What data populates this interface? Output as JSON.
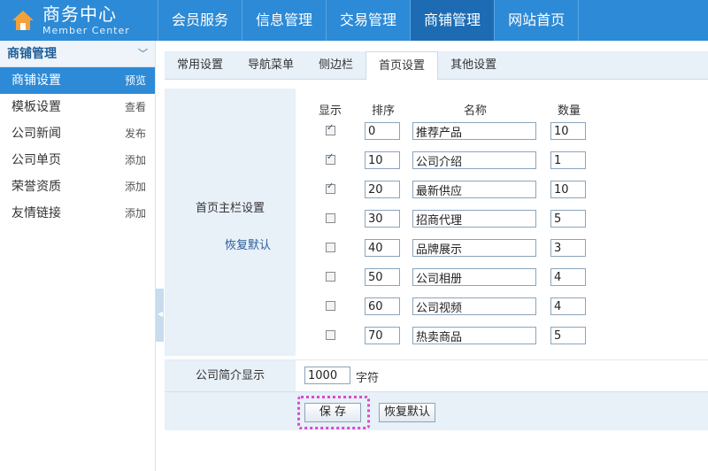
{
  "brand": {
    "title": "商务中心",
    "subtitle": "Member Center",
    "icon": "house-icon"
  },
  "nav": {
    "items": [
      {
        "label": "会员服务"
      },
      {
        "label": "信息管理"
      },
      {
        "label": "交易管理"
      },
      {
        "label": "商铺管理",
        "active": true
      },
      {
        "label": "网站首页"
      }
    ]
  },
  "sidebar": {
    "title": "商铺管理",
    "items": [
      {
        "label": "商铺设置",
        "action": "预览",
        "active": true
      },
      {
        "label": "模板设置",
        "action": "查看"
      },
      {
        "label": "公司新闻",
        "action": "发布"
      },
      {
        "label": "公司单页",
        "action": "添加"
      },
      {
        "label": "荣誉资质",
        "action": "添加"
      },
      {
        "label": "友情链接",
        "action": "添加"
      }
    ]
  },
  "tabs": [
    {
      "label": "常用设置"
    },
    {
      "label": "导航菜单"
    },
    {
      "label": "侧边栏"
    },
    {
      "label": "首页设置",
      "active": true
    },
    {
      "label": "其他设置"
    }
  ],
  "home_columns": {
    "label": "首页主栏设置",
    "restore_link": "恢复默认",
    "headers": {
      "show": "显示",
      "order": "排序",
      "name": "名称",
      "qty": "数量"
    },
    "rows": [
      {
        "show": true,
        "order": "0",
        "name": "推荐产品",
        "qty": "10"
      },
      {
        "show": true,
        "order": "10",
        "name": "公司介绍",
        "qty": "1"
      },
      {
        "show": true,
        "order": "20",
        "name": "最新供应",
        "qty": "10"
      },
      {
        "show": false,
        "order": "30",
        "name": "招商代理",
        "qty": "5"
      },
      {
        "show": false,
        "order": "40",
        "name": "品牌展示",
        "qty": "3"
      },
      {
        "show": false,
        "order": "50",
        "name": "公司相册",
        "qty": "4"
      },
      {
        "show": false,
        "order": "60",
        "name": "公司视频",
        "qty": "4"
      },
      {
        "show": false,
        "order": "70",
        "name": "热卖商品",
        "qty": "5"
      }
    ]
  },
  "intro": {
    "label": "公司简介显示",
    "value": "1000",
    "unit": "字符"
  },
  "buttons": {
    "save": "保 存",
    "reset": "恢复默认"
  },
  "colors": {
    "topbar": "#2d8ad6",
    "active_nav": "#1d6cb3",
    "panel_bg": "#e8f0f8",
    "focus_ring": "#d94ad0"
  }
}
